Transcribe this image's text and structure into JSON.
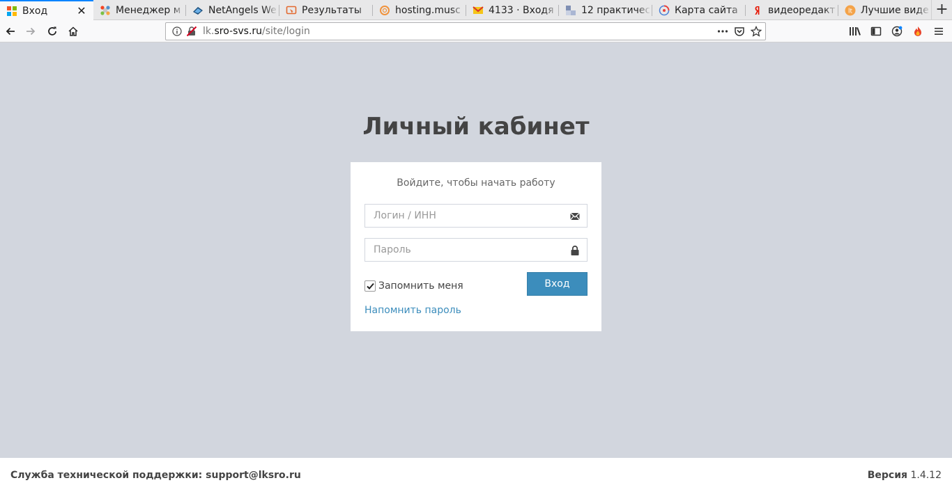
{
  "browser": {
    "tabs": [
      {
        "title": "Вход",
        "active": true,
        "icon": "windows-grid-icon"
      },
      {
        "title": "Менеджер м",
        "icon": "joomla-icon"
      },
      {
        "title": "NetAngels We",
        "icon": "netangels-icon"
      },
      {
        "title": "Результаты",
        "icon": "results-icon"
      },
      {
        "title": "hosting.musc",
        "icon": "ring-icon"
      },
      {
        "title": "4133 · Входя",
        "icon": "mail-icon"
      },
      {
        "title": "12 практичес",
        "icon": "blocks-icon"
      },
      {
        "title": "Карта сайта",
        "icon": "sitemap-icon"
      },
      {
        "title": "видеоредакт",
        "icon": "yandex-icon"
      },
      {
        "title": "Лучшие виде",
        "icon": "lt-icon"
      }
    ],
    "url": {
      "prefix": "lk.",
      "host": "sro-svs.ru",
      "path": "/site/login"
    },
    "colors": {
      "active_tab_accent": "#0a84ff"
    }
  },
  "page": {
    "title": "Личный кабинет",
    "login_message": "Войдите, чтобы начать работу",
    "login_placeholder": "Логин / ИНН",
    "password_placeholder": "Пароль",
    "remember_label": "Запомнить меня",
    "remember_checked": true,
    "submit_label": "Вход",
    "forgot_label": "Напомнить пароль",
    "colors": {
      "background": "#d2d6de",
      "primary": "#3c8dbc"
    }
  },
  "footer": {
    "support_text": "Служба технической поддержки: support@lksro.ru",
    "version_label": "Версия",
    "version_value": "1.4.12"
  }
}
